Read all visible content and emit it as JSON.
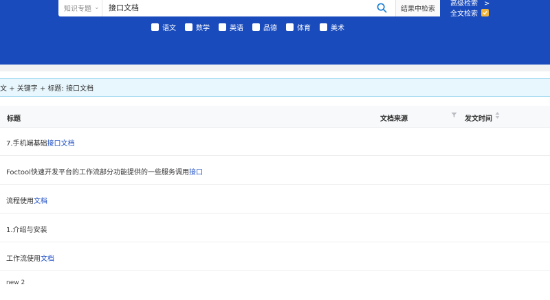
{
  "header": {
    "scope_label": "知识专题",
    "query": "接口文档",
    "search_within_label": "结果中检索",
    "advanced_search_label": "高级检索",
    "advanced_arrow": ">",
    "fulltext_label": "全文检索",
    "fulltext_checked": true,
    "subjects": [
      "语文",
      "数学",
      "英语",
      "品德",
      "体育",
      "美术"
    ]
  },
  "filter_bar": {
    "text": "文 + 关键字 + 标题: 接口文档"
  },
  "table": {
    "columns": {
      "title": "标题",
      "source": "文档来源",
      "time": "发文时间"
    },
    "rows": [
      {
        "prefix": "7.手机端基础",
        "highlight": "接口文档",
        "suffix": ""
      },
      {
        "prefix": "Foctool快速开发平台的工作流部分功能提供的一些服务调用",
        "highlight": "接口",
        "suffix": ""
      },
      {
        "prefix": "流程使用",
        "highlight": "文档",
        "suffix": ""
      },
      {
        "prefix": "1.介绍与安装",
        "highlight": "",
        "suffix": ""
      },
      {
        "prefix": "工作流使用",
        "highlight": "文档",
        "suffix": ""
      },
      {
        "prefix": "new 2",
        "highlight": "",
        "suffix": ""
      }
    ]
  },
  "colors": {
    "header_bg": "#1a4bbd",
    "highlight": "#1f4fc4",
    "checkbox_checked": "#f2b53b"
  }
}
